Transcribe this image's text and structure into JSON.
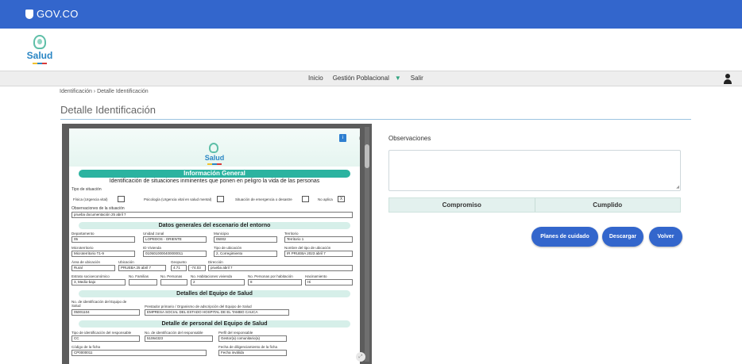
{
  "gov_bar": {
    "logo_text": "GOV.CO",
    "color": "#3366cc"
  },
  "brand": {
    "name": "Salud"
  },
  "nav": {
    "items": [
      "Inicio",
      "Gestión Poblacional",
      "Salir"
    ],
    "dropdown_icon": "triangle-down-icon",
    "user_icon": "user-icon"
  },
  "breadcrumb": "Identificación › Detalle Identificación",
  "page_title": "Detalle Identificación",
  "document": {
    "brand": "Salud",
    "section_general": "Información General",
    "subtitle": "Identificación de situaciones inminentes que ponen en peligro la vida de las personas",
    "tipo_situacion_label": "Tipo de situación",
    "situaciones": [
      {
        "label": "Física (Urgencia vital)",
        "value": ""
      },
      {
        "label": "Psicología (Urgencia vital en salud mental)",
        "value": ""
      },
      {
        "label": "Situación de emergencia o desastre",
        "value": ""
      },
      {
        "label": "No aplica",
        "value": "X"
      }
    ],
    "obs_situacion_label": "Observaciones de la situación",
    "obs_situacion_value": "prueba documentación 25 abril 7",
    "section_entorno": "Datos generales del escenario del entorno",
    "row1": [
      {
        "label": "Departamento",
        "value": "05"
      },
      {
        "label": "Unidad zonal",
        "value": "LOPEDOS - ORIENTE"
      },
      {
        "label": "Municipio",
        "value": "05002"
      },
      {
        "label": "Territorio",
        "value": "Territorio 1"
      }
    ],
    "row2": [
      {
        "label": "Microterritorio",
        "value": "Microterritorio T1-9"
      },
      {
        "label": "ID Vivienda",
        "value": "0105010000400000011"
      },
      {
        "label": "Tipo de ubicación",
        "value": "2, Corregimiento"
      },
      {
        "label": "Nombre del tipo de ubicación",
        "value": "IR PRUEBA 2023 abril 7"
      }
    ],
    "row3": [
      {
        "label": "Área de ubicación",
        "value": "Rural"
      },
      {
        "label": "Ubicación",
        "value": "PRUEBA 25 abril 7"
      },
      {
        "label": "Geopunto",
        "value": "4.71"
      },
      {
        "label": "",
        "value": "-74.03"
      },
      {
        "label": "Dirección",
        "value": "prueba abril 7"
      }
    ],
    "row4": [
      {
        "label": "Estrato socioeconómico",
        "value": "3, Medio-bajo"
      },
      {
        "label": "No. Familias",
        "value": ""
      },
      {
        "label": "No. Personas",
        "value": ""
      },
      {
        "label": "No. Habitaciones vivienda",
        "value": "2"
      },
      {
        "label": "No. Personas por habitación",
        "value": "8"
      },
      {
        "label": "Hacinamiento",
        "value": "Hi"
      }
    ],
    "section_equipo": "Detalles del Equipo de Salud",
    "equipo": [
      {
        "label": "No. de identificación del Equipo de Salud",
        "value": "05001104"
      },
      {
        "label": "Prestador primario / Organismo de adscripción del Equipo de Salud",
        "value": "EMPRESA SOCIAL DEL ESTADO HOSPITAL DE EL TAMBO CAUCA"
      }
    ],
    "section_personal": "Detalle de personal del Equipo de Salud",
    "personal": [
      {
        "label": "Tipo de identificación del responsable",
        "value": "CC"
      },
      {
        "label": "No. de identificación del responsable",
        "value": "51064323"
      },
      {
        "label": "Perfil del responsable",
        "value": "Gestor(a) comunitario(a)"
      }
    ],
    "ficha": [
      {
        "label": "Código de la ficha",
        "value": "CP0000011"
      },
      {
        "label": "Fecha de diligenciamiento de la ficha",
        "value": "Fecha inválida"
      }
    ]
  },
  "observaciones": {
    "label": "Observaciones",
    "value": ""
  },
  "table": {
    "headers": [
      "Compromiso",
      "Cumplido"
    ]
  },
  "actions": {
    "planes": "Planes de cuidado",
    "descargar": "Descargar",
    "volver": "Volver"
  }
}
